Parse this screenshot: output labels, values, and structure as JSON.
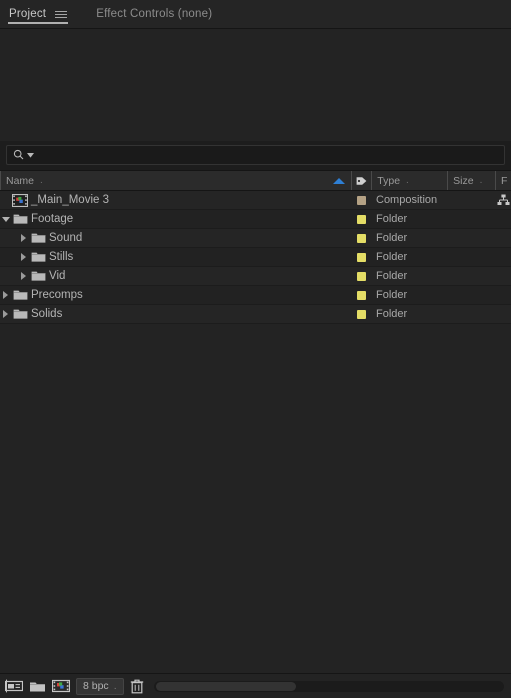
{
  "tabs": [
    {
      "label": "Project",
      "active": true,
      "menu_icon": "hamburger-icon"
    },
    {
      "label": "Effect Controls (none)",
      "active": false
    }
  ],
  "search": {
    "placeholder": "",
    "value": "",
    "icon": "search-icon",
    "dropdown_icon": "chevron-down-icon"
  },
  "columns": {
    "name": "Name",
    "label": "label-tag-icon",
    "type": "Type",
    "size": "Size",
    "f": "F",
    "sort": {
      "column": "Name",
      "direction": "ascending",
      "color": "#2e7fd4"
    }
  },
  "items": [
    {
      "name": "_Main_Movie 3",
      "icon": "composition-icon",
      "type": "Composition",
      "size": "",
      "label_color": "#b4a184",
      "indent": 0,
      "twisty": "none",
      "flowchart_icon": true
    },
    {
      "name": "Footage",
      "icon": "folder-icon",
      "type": "Folder",
      "size": "",
      "label_color": "#e4dd66",
      "indent": 0,
      "twisty": "expanded",
      "flowchart_icon": false
    },
    {
      "name": "Sound",
      "icon": "folder-icon",
      "type": "Folder",
      "size": "",
      "label_color": "#e4dd66",
      "indent": 1,
      "twisty": "collapsed",
      "flowchart_icon": false
    },
    {
      "name": "Stills",
      "icon": "folder-icon",
      "type": "Folder",
      "size": "",
      "label_color": "#e4dd66",
      "indent": 1,
      "twisty": "collapsed",
      "flowchart_icon": false
    },
    {
      "name": "Vid",
      "icon": "folder-icon",
      "type": "Folder",
      "size": "",
      "label_color": "#e4dd66",
      "indent": 1,
      "twisty": "collapsed",
      "flowchart_icon": false
    },
    {
      "name": "Precomps",
      "icon": "folder-icon",
      "type": "Folder",
      "size": "",
      "label_color": "#e4dd66",
      "indent": 0,
      "twisty": "collapsed",
      "flowchart_icon": false
    },
    {
      "name": "Solids",
      "icon": "folder-icon",
      "type": "Folder",
      "size": "",
      "label_color": "#e4dd66",
      "indent": 0,
      "twisty": "collapsed",
      "flowchart_icon": false
    }
  ],
  "bottom_bar": {
    "buttons": [
      {
        "name": "project-settings-icon"
      },
      {
        "name": "new-folder-icon"
      },
      {
        "name": "new-composition-icon"
      }
    ],
    "bit_depth": "8 bpc",
    "bit_depth_dot": ".",
    "delete_icon": "trash-icon",
    "scrollbar": {
      "thumb_percent": 40
    }
  }
}
